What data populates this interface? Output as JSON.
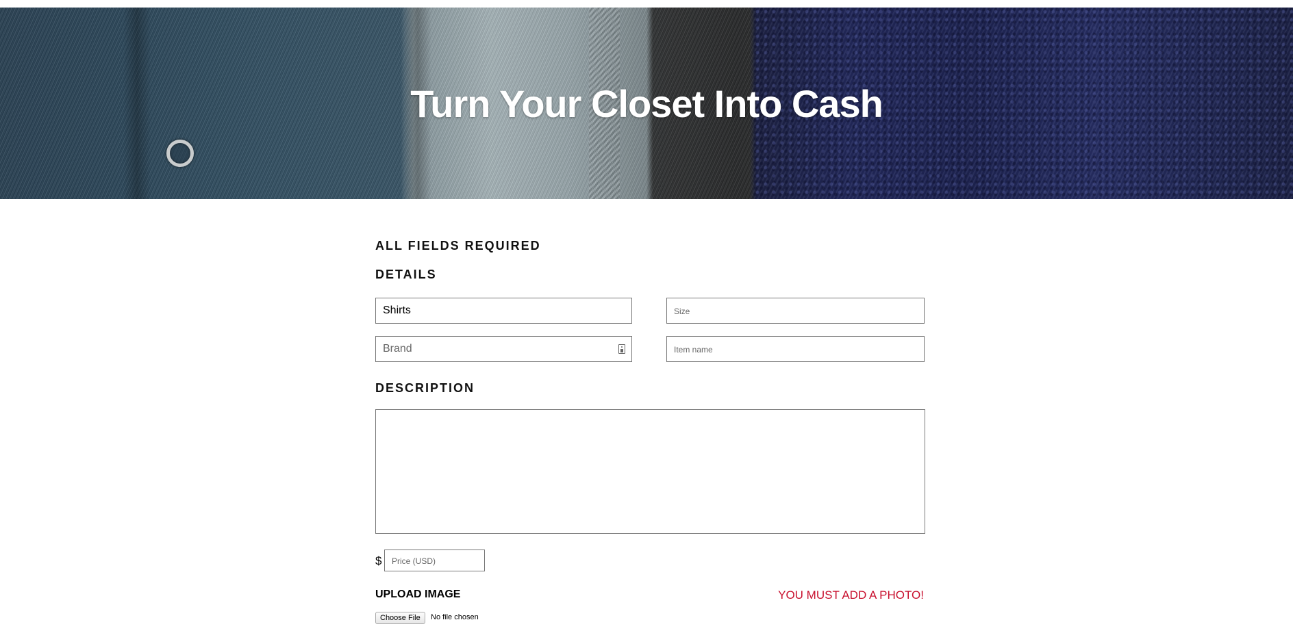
{
  "hero": {
    "title": "Turn Your Closet Into Cash"
  },
  "form": {
    "required_note": "ALL FIELDS REQUIRED",
    "details_heading": "DETAILS",
    "category_value": "Shirts",
    "size_placeholder": "Size",
    "brand_placeholder": "Brand",
    "item_name_placeholder": "Item name",
    "description_heading": "DESCRIPTION",
    "description_value": "",
    "currency_symbol": "$",
    "price_placeholder": "Price (USD)",
    "upload_heading": "UPLOAD IMAGE",
    "photo_warning": "YOU MUST ADD A PHOTO!",
    "choose_file_label": "Choose File",
    "file_status": "No file chosen"
  },
  "colors": {
    "warning": "#c8102e",
    "hero_text": "#ffffff",
    "border": "#777777"
  },
  "icons": {
    "brand_field_icon": "autofill-contact-icon"
  }
}
